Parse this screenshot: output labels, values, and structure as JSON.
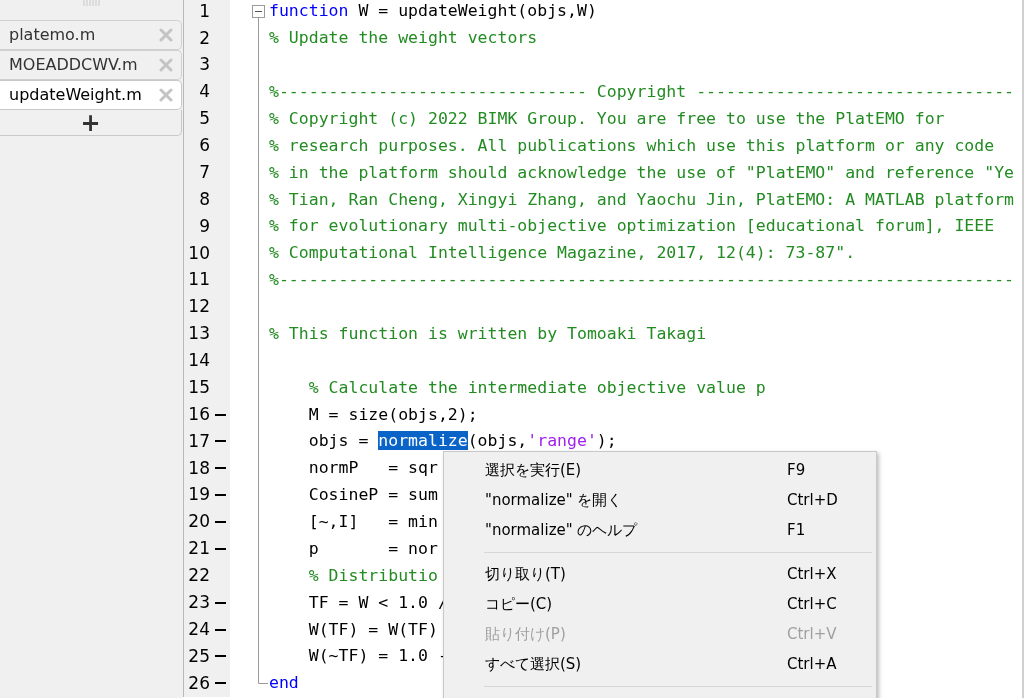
{
  "file_tabs": {
    "items": [
      {
        "label": "platemo.m",
        "selected": false
      },
      {
        "label": "MOEADDCWV.m",
        "selected": false
      },
      {
        "label": "updateWeight.m",
        "selected": true
      }
    ],
    "add_label": "+"
  },
  "editor": {
    "lines": [
      {
        "number": "1",
        "exec": false,
        "fold_start": true,
        "tokens": [
          {
            "kind": "keyword",
            "text": "function"
          },
          {
            "kind": "plain",
            "text": " W = updateWeight(objs,W)"
          }
        ]
      },
      {
        "number": "2",
        "exec": false,
        "tokens": [
          {
            "kind": "comment",
            "text": "% Update the weight vectors"
          }
        ]
      },
      {
        "number": "3",
        "exec": false
      },
      {
        "number": "4",
        "exec": false,
        "tokens": [
          {
            "kind": "comment",
            "text": "%------------------------------- Copyright --------------------------------"
          }
        ]
      },
      {
        "number": "5",
        "exec": false,
        "tokens": [
          {
            "kind": "comment",
            "text": "% Copyright (c) 2022 BIMK Group. You are free to use the PlatEMO for"
          }
        ]
      },
      {
        "number": "6",
        "exec": false,
        "tokens": [
          {
            "kind": "comment",
            "text": "% research purposes. All publications which use this platform or any code"
          }
        ]
      },
      {
        "number": "7",
        "exec": false,
        "tokens": [
          {
            "kind": "comment",
            "text": "% in the platform should acknowledge the use of \"PlatEMO\" and reference \"Ye"
          }
        ]
      },
      {
        "number": "8",
        "exec": false,
        "tokens": [
          {
            "kind": "comment",
            "text": "% Tian, Ran Cheng, Xingyi Zhang, and Yaochu Jin, PlatEMO: A MATLAB platform"
          }
        ]
      },
      {
        "number": "9",
        "exec": false,
        "tokens": [
          {
            "kind": "comment",
            "text": "% for evolutionary multi-objective optimization [educational forum], IEEE"
          }
        ]
      },
      {
        "number": "10",
        "exec": false,
        "tokens": [
          {
            "kind": "comment",
            "text": "% Computational Intelligence Magazine, 2017, 12(4): 73-87\"."
          }
        ]
      },
      {
        "number": "11",
        "exec": false,
        "tokens": [
          {
            "kind": "comment",
            "text": "%--------------------------------------------------------------------------"
          }
        ]
      },
      {
        "number": "12",
        "exec": false
      },
      {
        "number": "13",
        "exec": false,
        "tokens": [
          {
            "kind": "comment",
            "text": "% This function is written by Tomoaki Takagi"
          }
        ]
      },
      {
        "number": "14",
        "exec": false
      },
      {
        "number": "15",
        "exec": false,
        "tokens": [
          {
            "kind": "comment",
            "text": "    % Calculate the intermediate objective value p"
          }
        ]
      },
      {
        "number": "16",
        "exec": true,
        "tokens": [
          {
            "kind": "plain",
            "text": "    M = size(objs,2);"
          }
        ]
      },
      {
        "number": "17",
        "exec": true,
        "tokens": [
          {
            "kind": "plain",
            "text": "    objs = "
          },
          {
            "kind": "selected",
            "text": "normalize"
          },
          {
            "kind": "plain",
            "text": "(objs,"
          },
          {
            "kind": "string",
            "text": "'range'"
          },
          {
            "kind": "plain",
            "text": ");"
          }
        ]
      },
      {
        "number": "18",
        "exec": true,
        "tokens": [
          {
            "kind": "plain",
            "text": "    normP   = sqr"
          }
        ]
      },
      {
        "number": "19",
        "exec": true,
        "tokens": [
          {
            "kind": "plain",
            "text": "    CosineP = sum"
          }
        ]
      },
      {
        "number": "20",
        "exec": true,
        "tokens": [
          {
            "kind": "plain",
            "text": "    [~,I]   = min"
          }
        ]
      },
      {
        "number": "21",
        "exec": true,
        "tokens": [
          {
            "kind": "plain",
            "text": "    p       = nor"
          }
        ]
      },
      {
        "number": "22",
        "exec": false,
        "tokens": [
          {
            "kind": "comment",
            "text": "    % Distributio"
          }
        ]
      },
      {
        "number": "23",
        "exec": true,
        "tokens": [
          {
            "kind": "plain",
            "text": "    TF = W < 1.0 /"
          }
        ]
      },
      {
        "number": "24",
        "exec": true,
        "tokens": [
          {
            "kind": "plain",
            "text": "    W(TF) = W(TF)"
          }
        ]
      },
      {
        "number": "25",
        "exec": true,
        "tokens": [
          {
            "kind": "plain",
            "text": "    W(~TF) = 1.0 -"
          }
        ]
      },
      {
        "number": "26",
        "exec": true,
        "fold_end": true,
        "tokens": [
          {
            "kind": "keyword",
            "text": "end"
          }
        ]
      }
    ]
  },
  "context_menu": {
    "items": [
      {
        "kind": "item",
        "label": "選択を実行(E)",
        "shortcut": "F9",
        "disabled": false
      },
      {
        "kind": "item",
        "label": "\"normalize\" を開く",
        "shortcut": "Ctrl+D",
        "disabled": false
      },
      {
        "kind": "item",
        "label": "\"normalize\" のヘルプ",
        "shortcut": "F1",
        "disabled": false
      },
      {
        "kind": "separator"
      },
      {
        "kind": "item",
        "label": "切り取り(T)",
        "shortcut": "Ctrl+X",
        "disabled": false
      },
      {
        "kind": "item",
        "label": "コピー(C)",
        "shortcut": "Ctrl+C",
        "disabled": false
      },
      {
        "kind": "item",
        "label": "貼り付け(P)",
        "shortcut": "Ctrl+V",
        "disabled": true
      },
      {
        "kind": "item",
        "label": "すべて選択(S)",
        "shortcut": "Ctrl+A",
        "disabled": false
      },
      {
        "kind": "separator"
      }
    ]
  }
}
